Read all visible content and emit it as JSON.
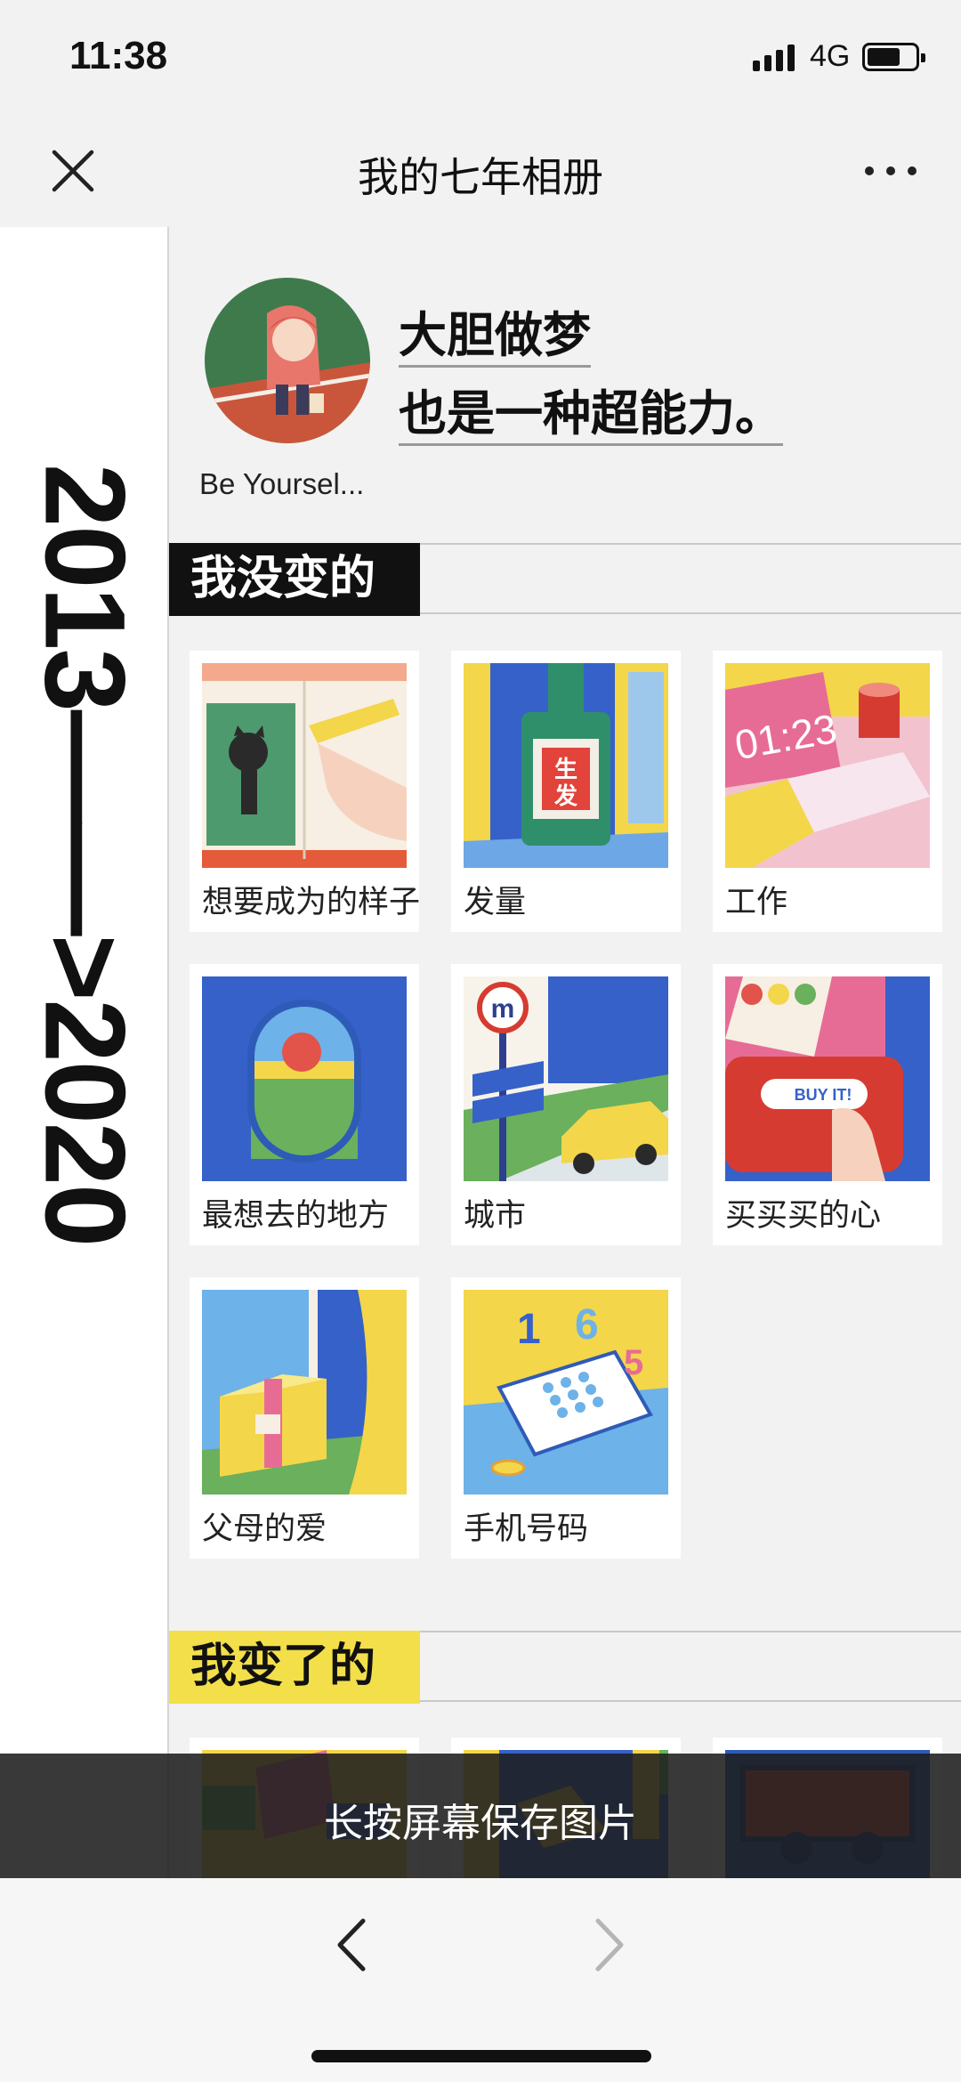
{
  "status": {
    "time": "11:38",
    "network": "4G",
    "battery_level": 0.7
  },
  "nav": {
    "title": "我的七年相册"
  },
  "sidebar": {
    "years": "2013——>2020"
  },
  "profile": {
    "motto_line1": "大胆做梦",
    "motto_line2": "也是一种超能力。",
    "name": "Be Yoursel..."
  },
  "sections": [
    {
      "title": "我没变的",
      "items": [
        {
          "label": "想要成为的样子",
          "icon": "sketchbook-batman-icon"
        },
        {
          "label": "发量",
          "icon": "hair-tonic-bottle-icon"
        },
        {
          "label": "工作",
          "icon": "laptop-clock-icon"
        },
        {
          "label": "最想去的地方",
          "icon": "airplane-window-icon"
        },
        {
          "label": "城市",
          "icon": "metro-street-taxi-icon"
        },
        {
          "label": "买买买的心",
          "icon": "shopping-buy-it-icon"
        },
        {
          "label": "父母的爱",
          "icon": "gift-package-icon"
        },
        {
          "label": "手机号码",
          "icon": "phone-keypad-icon"
        }
      ]
    },
    {
      "title": "我变了的"
    }
  ],
  "toast": {
    "text": "长按屏幕保存图片"
  },
  "colors": {
    "accent_yellow": "#f3df49",
    "section1_tag": "#111111"
  }
}
